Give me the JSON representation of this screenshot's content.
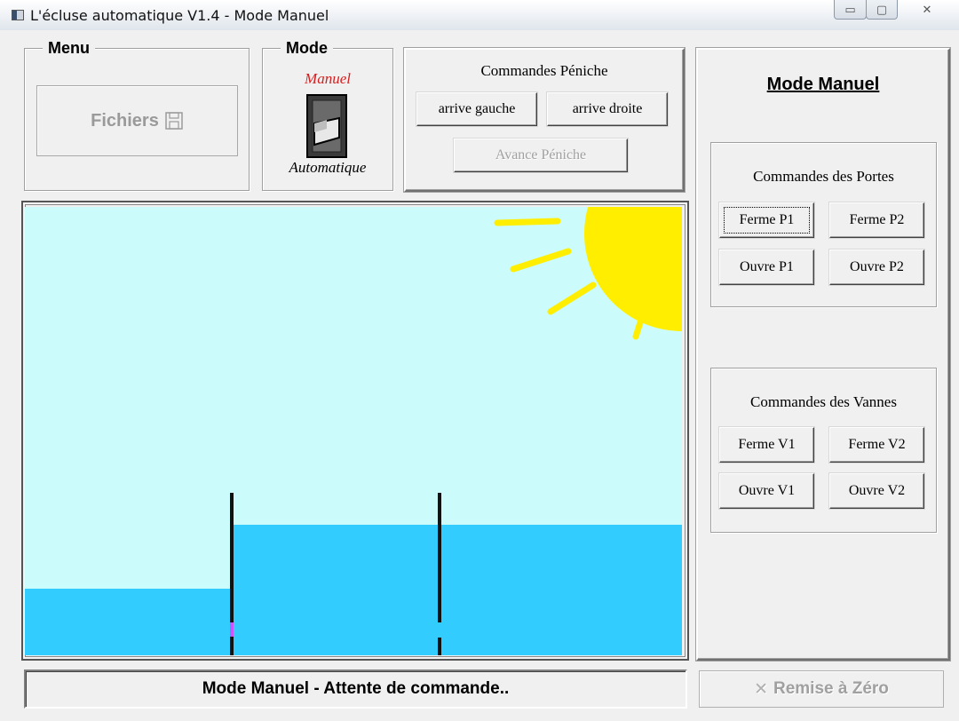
{
  "window": {
    "title": "L'écluse automatique V1.4 - Mode Manuel"
  },
  "menu": {
    "legend": "Menu",
    "fichiers_label": "Fichiers"
  },
  "mode": {
    "legend": "Mode",
    "manuel_label": "Manuel",
    "automatique_label": "Automatique",
    "current": "Manuel"
  },
  "commandes_peniche": {
    "title": "Commandes Péniche",
    "arrive_gauche": "arrive gauche",
    "arrive_droite": "arrive droite",
    "avance_peniche": "Avance Péniche"
  },
  "right_panel": {
    "heading": "Mode Manuel",
    "portes": {
      "title": "Commandes des Portes",
      "ferme_p1": "Ferme P1",
      "ferme_p2": "Ferme P2",
      "ouvre_p1": "Ouvre P1",
      "ouvre_p2": "Ouvre P2"
    },
    "vannes": {
      "title": "Commandes des Vannes",
      "ferme_v1": "Ferme V1",
      "ferme_v2": "Ferme V2",
      "ouvre_v1": "Ouvre V1",
      "ouvre_v2": "Ouvre V2"
    }
  },
  "status": {
    "message": "Mode Manuel - Attente de commande..",
    "remise_label": "Remise à Zéro"
  },
  "scene_colors": {
    "sky": "#ccfbfb",
    "water": "#33ccff",
    "sun": "#ffee00",
    "gate": "#111111"
  }
}
